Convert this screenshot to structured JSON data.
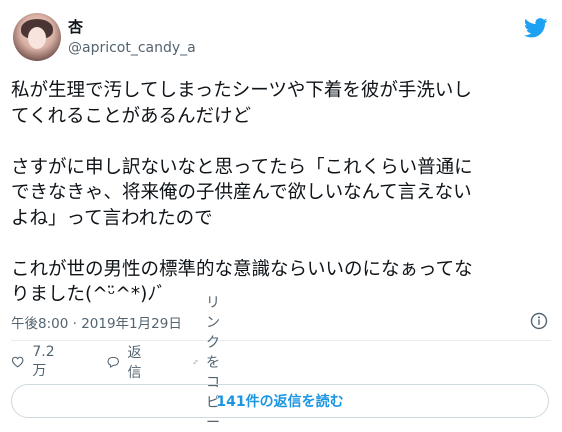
{
  "user": {
    "display_name": "杏",
    "username": "@apricot_candy_a"
  },
  "tweet": {
    "lines_p1": [
      "私が生理で汚してしまったシーツや下着を彼が手洗いし",
      "てくれることがあるんだけど"
    ],
    "lines_p2": [
      "さすがに申し訳ないなと思ってたら「これくらい普通に",
      "できなきゃ、将来俺の子供産んで欲しいなんて言えない",
      "よね」って言われたので"
    ],
    "lines_p3": [
      "これが世の男性の標準的な意識ならいいのになぁってな",
      "りました(^ᵕ̈^*)ﾉﾞ"
    ]
  },
  "timestamp": "午後8:00 · 2019年1月29日",
  "actions": {
    "likes": "7.2万",
    "reply_label": "返信",
    "copy_link_label": "リンクをコピー"
  },
  "replies_button_label": "141件の返信を読む",
  "colors": {
    "brand_blue": "#1da1f2",
    "link_blue": "#1b95e0",
    "secondary_text": "#536471",
    "like_pink": "#e0245e"
  },
  "icons": {
    "logo": "twitter-bird-icon",
    "info": "info-icon",
    "like": "heart-icon",
    "reply": "speech-bubble-icon",
    "link": "link-icon"
  }
}
